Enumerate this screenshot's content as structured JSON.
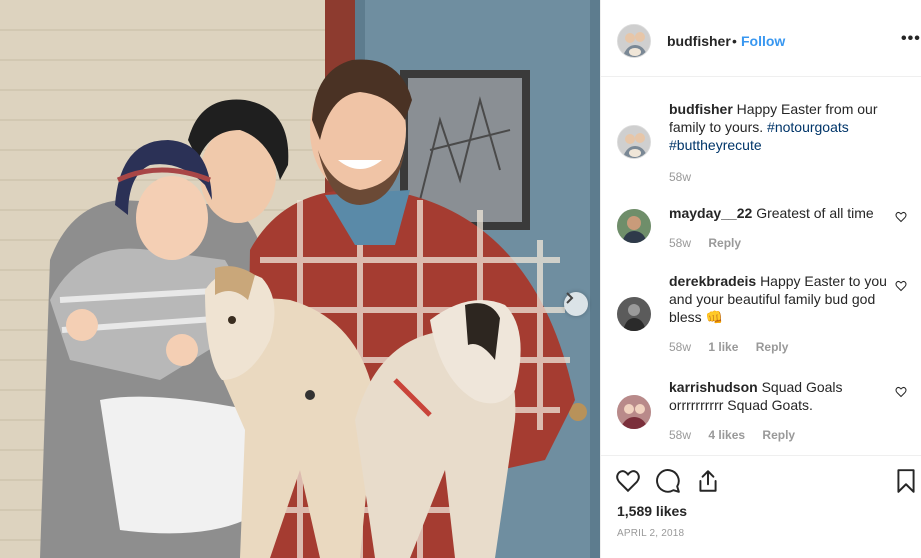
{
  "post": {
    "username": "budfisher",
    "dot": "•",
    "follow_label": "Follow",
    "more_label": "•••",
    "caption": {
      "username": "budfisher",
      "text": "Happy Easter from our family to yours.",
      "hashtag1": "#notourgoats",
      "hashtag2": "#buttheyrecute",
      "time": "58w"
    },
    "comments": [
      {
        "username": "mayday__22",
        "text": "Greatest of all time",
        "time": "58w",
        "likes": "",
        "reply": "Reply"
      },
      {
        "username": "derekbradeis",
        "text": "Happy Easter to you and your beautiful family bud god bless 👊",
        "time": "58w",
        "likes": "1 like",
        "reply": "Reply"
      },
      {
        "username": "karrishudson",
        "text": "Squad Goals orrrrrrrrrr Squad Goats.",
        "time": "58w",
        "likes": "4 likes",
        "reply": "Reply"
      }
    ],
    "likes_label": "1,589 likes",
    "date_label": "APRIL 2, 2018"
  },
  "icons": {
    "header_avatar": "avatar-icon",
    "carousel": "chevron-right-icon",
    "like": "heart-icon",
    "comment": "comment-icon",
    "share": "share-icon",
    "save": "bookmark-icon",
    "comment_like": "heart-icon"
  },
  "colors": {
    "accent": "#3897f0",
    "hashtag": "#003569",
    "muted": "#999999",
    "text": "#262626"
  }
}
